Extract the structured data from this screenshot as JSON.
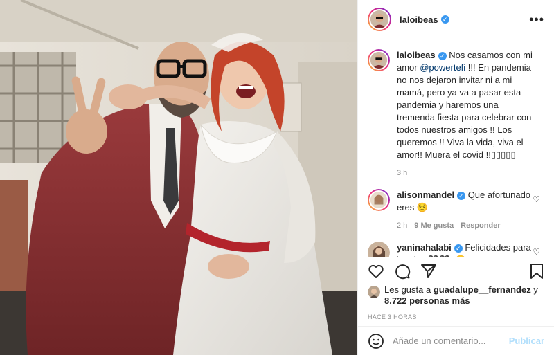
{
  "post": {
    "username": "laloibeas",
    "verified_mark": "✓",
    "more_icon": "•••"
  },
  "caption": {
    "username": "laloibeas",
    "text_before": " Nos casamos con mi amor ",
    "mention": "@powertefi",
    "text_after": " !!! En pandemia no nos dejaron invitar ni a mi mamá, pero ya va a pasar esta pandemia y haremos una tremenda fiesta para celebrar con todos nuestros amigos !! Los queremos !! Viva la vida, viva el amor!! Muera el covid !!▯▯▯▯▯",
    "time": "3 h"
  },
  "comments": [
    {
      "username": "alisonmandel",
      "text": " Que afortunado eres 😌",
      "time": "2 h",
      "likes": "9 Me gusta",
      "reply": "Responder"
    },
    {
      "username": "yaninahalabi",
      "text": " Felicidades para los dos 🖤🖤▯😌"
    }
  ],
  "likes": {
    "prefix": "Les gusta a ",
    "user": "guadalupe__fernandez",
    "joiner": " y",
    "count": "8.722 personas más"
  },
  "timestamp": "HACE 3 HORAS",
  "add_comment": {
    "placeholder": "Añade un comentario...",
    "publish": "Publicar"
  },
  "colors": {
    "accent": "#3897f0",
    "publish_disabled": "#b2dffc",
    "muted": "#8e8e8e"
  }
}
